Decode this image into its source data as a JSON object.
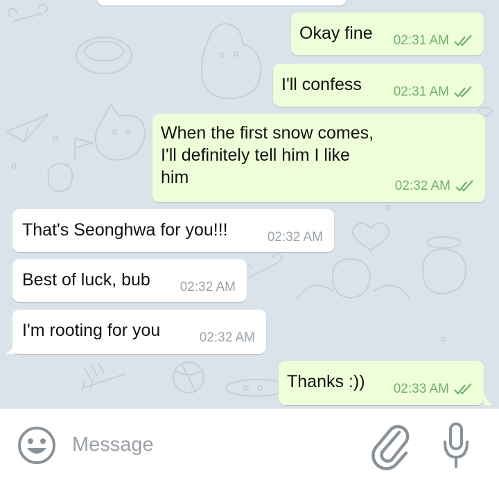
{
  "composer": {
    "placeholder": "Message",
    "emoji_icon": "smiley-face-icon",
    "attach_icon": "paperclip-icon",
    "mic_icon": "microphone-icon"
  },
  "messages": [
    {
      "direction": "outgoing",
      "text": "Okay fine",
      "time": "02:31 AM",
      "status": "read"
    },
    {
      "direction": "outgoing",
      "text": "I'll confess",
      "time": "02:31 AM",
      "status": "read"
    },
    {
      "direction": "outgoing",
      "text": "When the first snow comes,\nI'll definitely tell him I like\nhim",
      "time": "02:32 AM",
      "status": "read"
    },
    {
      "direction": "incoming",
      "text": "That's Seonghwa for you!!!",
      "time": "02:32 AM"
    },
    {
      "direction": "incoming",
      "text": "Best of luck, bub",
      "time": "02:32 AM"
    },
    {
      "direction": "incoming",
      "text": "I'm rooting for you",
      "time": "02:32 AM"
    },
    {
      "direction": "outgoing",
      "text": "Thanks :))",
      "time": "02:33 AM",
      "status": "read"
    }
  ],
  "colors": {
    "outgoing_bubble": "#eefed9",
    "incoming_bubble": "#ffffff",
    "outgoing_meta": "#6fb06a",
    "incoming_meta": "#9aa3ab",
    "chat_background": "#d9e3e9"
  }
}
